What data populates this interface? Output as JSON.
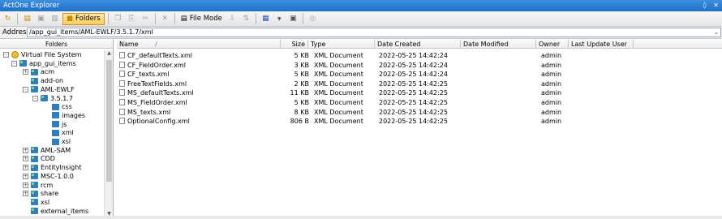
{
  "window": {
    "title": "ActOne Explorer",
    "pin_icon": "pin-icon",
    "close_icon": "close-icon"
  },
  "toolbar": {
    "folders_label": "Folders",
    "file_mode_label": "File Mode"
  },
  "address": {
    "label": "Address",
    "value": "/app_gui_items/AML-EWLF/3.5.1.7/xml"
  },
  "folders_pane": {
    "header": "Folders",
    "tree": [
      {
        "label": "Virtual File System",
        "icon": "vfs-icon",
        "expander": "-"
      },
      {
        "label": "app_gui_items",
        "icon": "folder-node-icon",
        "expander": "-"
      },
      {
        "label": "acm",
        "icon": "folder-node-icon",
        "expander": "+"
      },
      {
        "label": "add-on",
        "icon": "folder-node-icon",
        "expander": ""
      },
      {
        "label": "AML-EWLF",
        "icon": "folder-node-icon",
        "expander": "-"
      },
      {
        "label": "3.5.1.7",
        "icon": "folder-node-icon",
        "expander": "-"
      },
      {
        "label": "css",
        "icon": "folder-icon",
        "expander": ""
      },
      {
        "label": "images",
        "icon": "folder-icon",
        "expander": ""
      },
      {
        "label": "js",
        "icon": "folder-icon",
        "expander": ""
      },
      {
        "label": "xml",
        "icon": "folder-icon",
        "expander": ""
      },
      {
        "label": "xsl",
        "icon": "folder-icon",
        "expander": ""
      },
      {
        "label": "AML-SAM",
        "icon": "folder-node-icon",
        "expander": "+"
      },
      {
        "label": "CDD",
        "icon": "folder-node-icon",
        "expander": "+"
      },
      {
        "label": "EntityInsight",
        "icon": "folder-node-icon",
        "expander": "+"
      },
      {
        "label": "MSC-1.0.0",
        "icon": "folder-node-icon",
        "expander": "+"
      },
      {
        "label": "rcm",
        "icon": "folder-node-icon",
        "expander": "+"
      },
      {
        "label": "share",
        "icon": "folder-node-icon",
        "expander": "+"
      },
      {
        "label": "xsl",
        "icon": "folder-node-icon",
        "expander": ""
      },
      {
        "label": "external_items",
        "icon": "folder-node-icon",
        "expander": ""
      }
    ]
  },
  "files": {
    "columns": [
      "Name",
      "Size",
      "Type",
      "Date Created",
      "Date Modified",
      "Owner",
      "Last Update User"
    ],
    "rows": [
      {
        "name": "CF_defaultTexts.xml",
        "size": "5 KB",
        "type": "XML Document",
        "created": "2022-05-25 14:42:24",
        "modified": "",
        "owner": "admin",
        "user": ""
      },
      {
        "name": "CF_FieldOrder.xml",
        "size": "3 KB",
        "type": "XML Document",
        "created": "2022-05-25 14:42:24",
        "modified": "",
        "owner": "admin",
        "user": ""
      },
      {
        "name": "CF_texts.xml",
        "size": "5 KB",
        "type": "XML Document",
        "created": "2022-05-25 14:42:24",
        "modified": "",
        "owner": "admin",
        "user": ""
      },
      {
        "name": "FreeTextFields.xml",
        "size": "2 KB",
        "type": "XML Document",
        "created": "2022-05-25 14:42:25",
        "modified": "",
        "owner": "admin",
        "user": ""
      },
      {
        "name": "MS_defaultTexts.xml",
        "size": "11 KB",
        "type": "XML Document",
        "created": "2022-05-25 14:42:25",
        "modified": "",
        "owner": "admin",
        "user": ""
      },
      {
        "name": "MS_FieldOrder.xml",
        "size": "5 KB",
        "type": "XML Document",
        "created": "2022-05-25 14:42:25",
        "modified": "",
        "owner": "admin",
        "user": ""
      },
      {
        "name": "MS_texts.xml",
        "size": "8 KB",
        "type": "XML Document",
        "created": "2022-05-25 14:42:25",
        "modified": "",
        "owner": "admin",
        "user": ""
      },
      {
        "name": "OptionalConfig.xml",
        "size": "806 B",
        "type": "XML Document",
        "created": "2022-05-25 14:42:25",
        "modified": "",
        "owner": "admin",
        "user": ""
      }
    ]
  }
}
